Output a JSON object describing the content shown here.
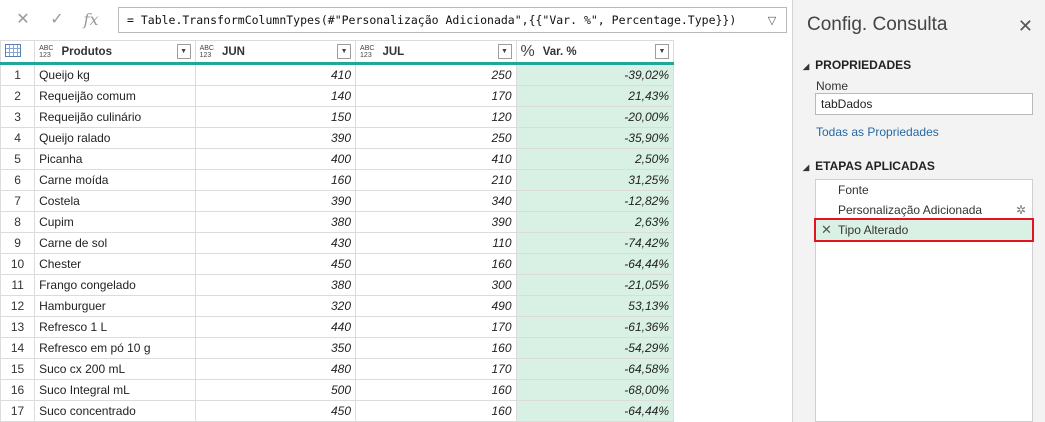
{
  "formula": {
    "cancel_icon": "close-icon",
    "confirm_icon": "check-icon",
    "fx_label": "fx",
    "text": "= Table.TransformColumnTypes(#\"Personalização Adicionada\",{{\"Var. %\", Percentage.Type}})"
  },
  "grid": {
    "columns": [
      {
        "label": "Produtos",
        "type_top": "ABC",
        "type_bottom": "123"
      },
      {
        "label": "JUN",
        "type_top": "ABC",
        "type_bottom": "123"
      },
      {
        "label": "JUL",
        "type_top": "ABC",
        "type_bottom": "123"
      },
      {
        "label": "Var. %",
        "type_symbol": "%"
      }
    ],
    "rows": [
      {
        "idx": "1",
        "prod": "Queijo kg",
        "jun": "410",
        "jul": "250",
        "var": "-39,02%"
      },
      {
        "idx": "2",
        "prod": "Requeijão comum",
        "jun": "140",
        "jul": "170",
        "var": "21,43%"
      },
      {
        "idx": "3",
        "prod": "Requeijão culinário",
        "jun": "150",
        "jul": "120",
        "var": "-20,00%"
      },
      {
        "idx": "4",
        "prod": "Queijo ralado",
        "jun": "390",
        "jul": "250",
        "var": "-35,90%"
      },
      {
        "idx": "5",
        "prod": "Picanha",
        "jun": "400",
        "jul": "410",
        "var": "2,50%"
      },
      {
        "idx": "6",
        "prod": "Carne moída",
        "jun": "160",
        "jul": "210",
        "var": "31,25%"
      },
      {
        "idx": "7",
        "prod": "Costela",
        "jun": "390",
        "jul": "340",
        "var": "-12,82%"
      },
      {
        "idx": "8",
        "prod": "Cupim",
        "jun": "380",
        "jul": "390",
        "var": "2,63%"
      },
      {
        "idx": "9",
        "prod": "Carne de sol",
        "jun": "430",
        "jul": "110",
        "var": "-74,42%"
      },
      {
        "idx": "10",
        "prod": "Chester",
        "jun": "450",
        "jul": "160",
        "var": "-64,44%"
      },
      {
        "idx": "11",
        "prod": "Frango congelado",
        "jun": "380",
        "jul": "300",
        "var": "-21,05%"
      },
      {
        "idx": "12",
        "prod": "Hamburguer",
        "jun": "320",
        "jul": "490",
        "var": "53,13%"
      },
      {
        "idx": "13",
        "prod": "Refresco 1 L",
        "jun": "440",
        "jul": "170",
        "var": "-61,36%"
      },
      {
        "idx": "14",
        "prod": "Refresco em pó 10 g",
        "jun": "350",
        "jul": "160",
        "var": "-54,29%"
      },
      {
        "idx": "15",
        "prod": "Suco cx 200 mL",
        "jun": "480",
        "jul": "170",
        "var": "-64,58%"
      },
      {
        "idx": "16",
        "prod": "Suco Integral mL",
        "jun": "500",
        "jul": "160",
        "var": "-68,00%"
      },
      {
        "idx": "17",
        "prod": "Suco concentrado",
        "jun": "450",
        "jul": "160",
        "var": "-64,44%"
      }
    ]
  },
  "panel": {
    "title": "Config. Consulta",
    "properties_header": "PROPRIEDADES",
    "name_label": "Nome",
    "name_value": "tabDados",
    "all_props_link": "Todas as Propriedades",
    "steps_header": "ETAPAS APLICADAS",
    "steps": [
      {
        "label": "Fonte"
      },
      {
        "label": "Personalização Adicionada"
      },
      {
        "label": "Tipo Alterado"
      }
    ]
  },
  "colors": {
    "accent": "#1fa89a",
    "selected_column": "#d9f1e4",
    "highlight_border": "#e2141f",
    "link": "#2569a5"
  }
}
